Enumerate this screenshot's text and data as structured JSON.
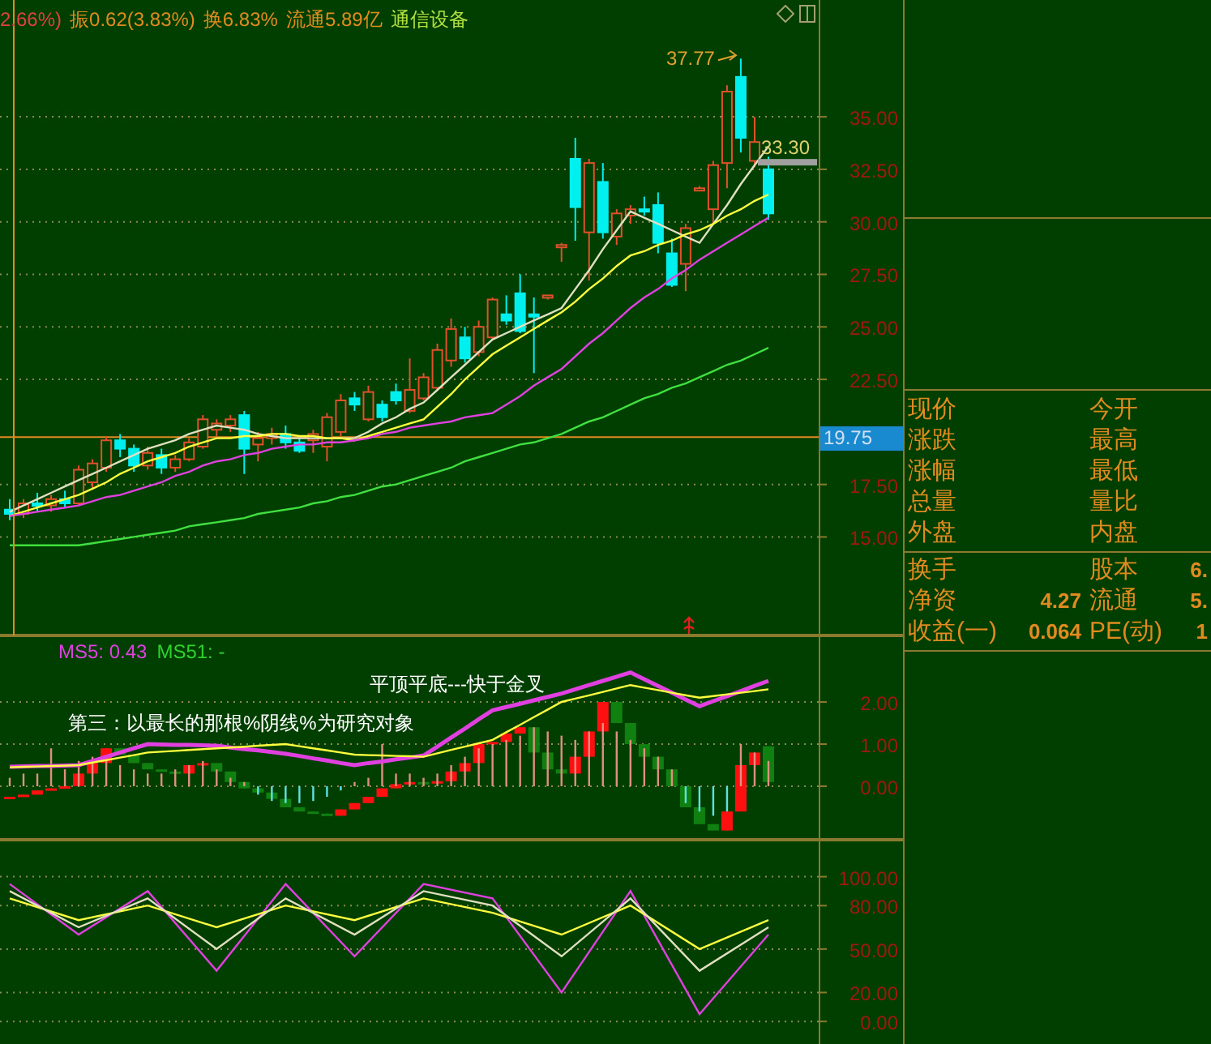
{
  "header": {
    "parts": [
      {
        "kind": "change",
        "text": "2.66%)"
      },
      {
        "kind": "stat",
        "text": "振0.62(3.83%)"
      },
      {
        "kind": "stat",
        "text": "换6.83%"
      },
      {
        "kind": "stat",
        "text": "流通5.89亿"
      },
      {
        "kind": "industry",
        "text": "通信设备"
      }
    ]
  },
  "price_chart": {
    "chart_data": {
      "type": "candlestick",
      "grid": true,
      "ylim": [
        10.31,
        40.56
      ],
      "yticks": [
        {
          "value": 15,
          "label": "15.00"
        },
        {
          "value": 17.5,
          "label": "17.50"
        },
        {
          "value": 22.5,
          "label": "22.50"
        },
        {
          "value": 25,
          "label": "25.00"
        },
        {
          "value": 27.5,
          "label": "27.50"
        },
        {
          "value": 30,
          "label": "30.00"
        },
        {
          "value": 32.5,
          "label": "32.50"
        },
        {
          "value": 35,
          "label": "35.00"
        }
      ],
      "ohlc": [
        [
          16.3,
          16.8,
          15.8,
          16.1
        ],
        [
          16.1,
          16.8,
          15.9,
          16.6
        ],
        [
          16.6,
          17.1,
          16.2,
          16.5
        ],
        [
          16.5,
          17.0,
          16.2,
          16.8
        ],
        [
          16.8,
          17.2,
          16.4,
          16.6
        ],
        [
          16.6,
          18.4,
          16.5,
          18.2
        ],
        [
          17.6,
          18.7,
          17.3,
          18.5
        ],
        [
          18.3,
          19.8,
          18.1,
          19.6
        ],
        [
          19.6,
          19.9,
          18.8,
          19.2
        ],
        [
          19.2,
          19.4,
          18.1,
          18.4
        ],
        [
          18.4,
          19.3,
          18.2,
          19.0
        ],
        [
          18.9,
          19.2,
          18.0,
          18.3
        ],
        [
          18.3,
          18.9,
          18.1,
          18.7
        ],
        [
          18.7,
          19.7,
          18.6,
          19.5
        ],
        [
          19.3,
          20.8,
          19.2,
          20.6
        ],
        [
          20.1,
          20.6,
          19.8,
          20.4
        ],
        [
          20.3,
          20.8,
          20.0,
          20.6
        ],
        [
          20.8,
          21.0,
          18.0,
          19.2
        ],
        [
          19.4,
          20.0,
          18.6,
          19.7
        ],
        [
          19.7,
          20.2,
          19.4,
          19.9
        ],
        [
          19.9,
          20.3,
          19.2,
          19.5
        ],
        [
          19.5,
          19.7,
          19.0,
          19.1
        ],
        [
          19.6,
          20.1,
          19.0,
          19.9
        ],
        [
          19.3,
          20.9,
          18.6,
          20.7
        ],
        [
          20.0,
          21.8,
          19.8,
          21.5
        ],
        [
          21.6,
          21.9,
          21.0,
          21.3
        ],
        [
          20.6,
          22.2,
          20.5,
          21.9
        ],
        [
          21.3,
          21.5,
          20.5,
          20.7
        ],
        [
          21.9,
          22.3,
          21.3,
          21.5
        ],
        [
          21.0,
          23.5,
          20.9,
          22.0
        ],
        [
          21.6,
          22.8,
          21.5,
          22.6
        ],
        [
          22.1,
          24.2,
          22.0,
          23.9
        ],
        [
          23.4,
          25.4,
          23.1,
          24.9
        ],
        [
          24.5,
          25.0,
          23.3,
          23.5
        ],
        [
          23.8,
          25.3,
          23.6,
          25.0
        ],
        [
          24.5,
          26.4,
          24.4,
          26.3
        ],
        [
          25.6,
          26.5,
          25.1,
          25.3
        ],
        [
          26.6,
          27.5,
          24.7,
          24.8
        ],
        [
          25.6,
          26.4,
          22.8,
          25.5
        ],
        [
          26.4,
          26.5,
          26.3,
          26.5
        ],
        [
          28.9,
          29.0,
          28.1,
          28.9
        ],
        [
          33.0,
          34.0,
          29.1,
          30.7
        ],
        [
          29.5,
          33.0,
          27.2,
          32.8
        ],
        [
          31.9,
          32.8,
          29.2,
          29.5
        ],
        [
          29.3,
          30.6,
          28.9,
          30.4
        ],
        [
          30.3,
          30.8,
          29.9,
          30.6
        ],
        [
          30.6,
          31.2,
          30.3,
          30.5
        ],
        [
          30.8,
          31.4,
          28.5,
          29.0
        ],
        [
          28.5,
          29.2,
          26.9,
          27.0
        ],
        [
          28.0,
          29.9,
          26.7,
          29.7
        ],
        [
          31.6,
          31.7,
          31.5,
          31.6
        ],
        [
          30.6,
          32.9,
          29.9,
          32.7
        ],
        [
          32.8,
          36.5,
          31.6,
          36.2
        ],
        [
          36.9,
          37.77,
          33.3,
          34.0
        ],
        [
          32.9,
          35.0,
          32.6,
          33.8
        ],
        [
          32.5,
          33.1,
          30.1,
          30.4
        ]
      ],
      "series": [
        {
          "type": "line",
          "color": "#e0e0c0",
          "values": [
            16.2,
            16.5,
            16.8,
            17.1,
            17.4,
            17.7,
            18.0,
            18.3,
            18.6,
            18.9,
            19.2,
            19.4,
            19.6,
            19.9,
            20.1,
            20.3,
            20.2,
            20.1,
            19.9,
            19.8,
            19.7,
            19.7,
            19.7,
            19.7,
            19.7,
            19.7,
            20.0,
            20.4,
            20.7,
            21.1,
            21.4,
            22.0,
            22.6,
            23.2,
            23.8,
            24.4,
            24.7,
            25.0,
            25.3,
            25.6,
            25.9,
            26.8,
            27.7,
            28.7,
            29.6,
            30.5,
            30.2,
            29.9,
            29.6,
            29.3,
            29.0,
            29.9,
            30.8,
            31.8,
            32.7,
            33.6
          ]
        },
        {
          "type": "line",
          "color": "#ffff40",
          "values": [
            16.0,
            16.2,
            16.4,
            16.6,
            16.8,
            17.0,
            17.3,
            17.6,
            18.0,
            18.3,
            18.6,
            18.8,
            19.0,
            19.3,
            19.5,
            19.7,
            19.7,
            19.8,
            19.8,
            19.9,
            19.9,
            19.8,
            19.8,
            19.7,
            19.7,
            19.6,
            19.8,
            20.0,
            20.2,
            20.4,
            20.6,
            21.2,
            21.8,
            22.5,
            23.1,
            23.7,
            24.1,
            24.5,
            24.9,
            25.3,
            25.7,
            26.2,
            26.8,
            27.3,
            27.9,
            28.4,
            28.6,
            28.9,
            29.1,
            29.4,
            29.6,
            29.9,
            30.3,
            30.6,
            31.0,
            31.3
          ]
        },
        {
          "type": "line",
          "color": "#e040e0",
          "values": [
            16.0,
            16.1,
            16.2,
            16.3,
            16.4,
            16.5,
            16.7,
            16.9,
            17.0,
            17.2,
            17.4,
            17.6,
            17.9,
            18.1,
            18.4,
            18.6,
            18.7,
            18.9,
            19.0,
            19.2,
            19.3,
            19.4,
            19.4,
            19.5,
            19.5,
            19.6,
            19.7,
            19.9,
            20.0,
            20.2,
            20.3,
            20.4,
            20.5,
            20.7,
            20.8,
            20.9,
            21.3,
            21.7,
            22.2,
            22.6,
            23.0,
            23.6,
            24.2,
            24.7,
            25.3,
            25.9,
            26.4,
            26.8,
            27.3,
            27.7,
            28.2,
            28.6,
            29.0,
            29.4,
            29.8,
            30.2
          ]
        },
        {
          "type": "line",
          "color": "#40e040",
          "values": [
            14.6,
            14.6,
            14.6,
            14.6,
            14.6,
            14.6,
            14.7,
            14.8,
            14.9,
            15.0,
            15.1,
            15.2,
            15.3,
            15.5,
            15.6,
            15.7,
            15.8,
            15.9,
            16.1,
            16.2,
            16.3,
            16.4,
            16.6,
            16.7,
            16.9,
            17.0,
            17.2,
            17.4,
            17.5,
            17.7,
            17.9,
            18.1,
            18.3,
            18.6,
            18.8,
            19.0,
            19.2,
            19.4,
            19.5,
            19.7,
            19.9,
            20.2,
            20.5,
            20.7,
            21.0,
            21.3,
            21.6,
            21.8,
            22.1,
            22.3,
            22.6,
            22.9,
            23.2,
            23.4,
            23.7,
            24.0
          ]
        }
      ],
      "ref_lines": [
        {
          "axis": "y",
          "value": 19.75,
          "color": "#e08a20"
        }
      ],
      "annotations": [
        "37.77",
        "33.30"
      ]
    },
    "current_price": "19.75"
  },
  "indicator_chart": {
    "legend": [
      {
        "text": "MS5: 0.43",
        "color": "#e040e0"
      },
      {
        "text": "MS51: -",
        "color": "#30d030"
      }
    ],
    "notes": [
      "平顶平底---快于金叉",
      "第三：以最长的那根%阴线%为研究对象"
    ],
    "chart_data": {
      "type": "candlestick",
      "grid": true,
      "ylim": [
        -1.27,
        3.54
      ],
      "yticks": [
        {
          "value": 0,
          "label": "0.00"
        },
        {
          "value": 1,
          "label": "1.00"
        },
        {
          "value": 2,
          "label": "2.00"
        }
      ],
      "ohlc": [
        [
          -0.3,
          -0.25,
          -0.3,
          -0.25
        ],
        [
          -0.25,
          -0.2,
          -0.25,
          -0.2
        ],
        [
          -0.2,
          -0.1,
          -0.2,
          -0.1
        ],
        [
          -0.1,
          -0.05,
          -0.1,
          -0.05
        ],
        [
          -0.05,
          0.0,
          -0.05,
          0.0
        ],
        [
          0.0,
          0.3,
          0.0,
          0.3
        ],
        [
          0.3,
          0.55,
          0.3,
          0.55
        ],
        [
          0.55,
          0.9,
          0.55,
          0.9
        ],
        [
          0.9,
          0.9,
          0.75,
          0.75
        ],
        [
          0.75,
          0.75,
          0.55,
          0.55
        ],
        [
          0.55,
          0.55,
          0.4,
          0.4
        ],
        [
          0.4,
          0.4,
          0.35,
          0.35
        ],
        [
          0.35,
          0.35,
          0.3,
          0.3
        ],
        [
          0.3,
          0.5,
          0.3,
          0.5
        ],
        [
          0.5,
          0.55,
          0.5,
          0.55
        ],
        [
          0.55,
          0.55,
          0.35,
          0.35
        ],
        [
          0.35,
          0.35,
          0.1,
          0.1
        ],
        [
          0.1,
          0.1,
          -0.05,
          -0.05
        ],
        [
          -0.05,
          -0.05,
          -0.15,
          -0.15
        ],
        [
          -0.15,
          -0.15,
          -0.3,
          -0.3
        ],
        [
          -0.3,
          -0.3,
          -0.5,
          -0.5
        ],
        [
          -0.5,
          -0.5,
          -0.6,
          -0.6
        ],
        [
          -0.6,
          -0.6,
          -0.65,
          -0.65
        ],
        [
          -0.65,
          -0.65,
          -0.7,
          -0.7
        ],
        [
          -0.7,
          -0.55,
          -0.7,
          -0.55
        ],
        [
          -0.55,
          -0.4,
          -0.55,
          -0.4
        ],
        [
          -0.4,
          -0.25,
          -0.4,
          -0.25
        ],
        [
          -0.25,
          -0.05,
          -0.25,
          -0.05
        ],
        [
          -0.05,
          0.05,
          -0.05,
          0.05
        ],
        [
          0.05,
          0.1,
          0.05,
          0.1
        ],
        [
          0.1,
          0.1,
          0.08,
          0.08
        ],
        [
          0.08,
          0.12,
          0.08,
          0.12
        ],
        [
          0.12,
          0.35,
          0.12,
          0.35
        ],
        [
          0.35,
          0.55,
          0.35,
          0.55
        ],
        [
          0.55,
          1.0,
          0.55,
          1.0
        ],
        [
          1.0,
          1.05,
          1.0,
          1.05
        ],
        [
          1.05,
          1.25,
          1.05,
          1.25
        ],
        [
          1.25,
          1.4,
          1.25,
          1.4
        ],
        [
          1.4,
          1.4,
          0.8,
          0.8
        ],
        [
          0.8,
          0.8,
          0.4,
          0.4
        ],
        [
          0.4,
          0.4,
          0.3,
          0.3
        ],
        [
          0.3,
          0.7,
          0.3,
          0.7
        ],
        [
          0.7,
          1.3,
          0.7,
          1.3
        ],
        [
          1.3,
          2.0,
          1.3,
          2.0
        ],
        [
          2.0,
          2.0,
          1.5,
          1.5
        ],
        [
          1.5,
          1.5,
          1.0,
          1.0
        ],
        [
          1.0,
          1.0,
          0.7,
          0.7
        ],
        [
          0.7,
          0.7,
          0.4,
          0.4
        ],
        [
          0.4,
          0.4,
          0.0,
          0.0
        ],
        [
          0.0,
          0.0,
          -0.5,
          -0.5
        ],
        [
          -0.5,
          -0.5,
          -0.9,
          -0.9
        ],
        [
          -0.9,
          -0.9,
          -1.05,
          -1.05
        ],
        [
          -1.05,
          -0.6,
          -1.05,
          -0.6
        ],
        [
          -0.6,
          0.5,
          -0.6,
          0.5
        ],
        [
          0.5,
          0.8,
          0.5,
          0.8
        ],
        [
          0.95,
          0.95,
          0.1,
          0.1
        ]
      ],
      "series": [
        {
          "type": "line",
          "color": "#e040e0",
          "values": [
            0.46,
            0.47,
            0.48,
            0.48,
            0.49,
            0.5,
            0.6,
            0.7,
            0.8,
            0.9,
            1.0,
            0.99,
            0.98,
            0.98,
            0.97,
            0.96,
            0.92,
            0.88,
            0.85,
            0.81,
            0.77,
            0.72,
            0.66,
            0.61,
            0.55,
            0.5,
            0.55,
            0.59,
            0.64,
            0.68,
            0.73,
            0.94,
            1.16,
            1.37,
            1.59,
            1.8,
            1.88,
            1.96,
            2.04,
            2.12,
            2.2,
            2.3,
            2.4,
            2.5,
            2.6,
            2.7,
            2.54,
            2.38,
            2.22,
            2.06,
            1.9,
            2.02,
            2.14,
            2.26,
            2.38,
            2.5
          ]
        },
        {
          "type": "line",
          "color": "#ffff40",
          "values": [
            0.45,
            0.46,
            0.47,
            0.48,
            0.49,
            0.5,
            0.56,
            0.62,
            0.68,
            0.74,
            0.8,
            0.82,
            0.84,
            0.86,
            0.88,
            0.9,
            0.92,
            0.94,
            0.96,
            0.98,
            1.0,
            0.95,
            0.9,
            0.85,
            0.8,
            0.75,
            0.74,
            0.73,
            0.72,
            0.71,
            0.7,
            0.78,
            0.86,
            0.94,
            1.02,
            1.1,
            1.28,
            1.46,
            1.64,
            1.82,
            2.0,
            2.08,
            2.16,
            2.24,
            2.32,
            2.4,
            2.34,
            2.28,
            2.22,
            2.16,
            2.1,
            2.14,
            2.18,
            2.22,
            2.26,
            2.3
          ]
        },
        {
          "type": "bar",
          "color": "#e09080",
          "values": [
            0.2,
            0.3,
            0.3,
            0.9,
            0.4,
            0.6,
            0.7,
            0.6,
            0.5,
            0.4,
            0.3,
            0.3,
            0.4,
            0.5,
            0.6,
            0.4,
            0.2,
            0.1,
            null,
            null,
            null,
            null,
            null,
            null,
            null,
            0.1,
            0.2,
            1.0,
            0.3,
            0.3,
            0.2,
            0.3,
            0.5,
            0.7,
            0.9,
            1.0,
            1.1,
            1.2,
            1.4,
            1.3,
            1.2,
            1.1,
            1.3,
            1.5,
            1.3,
            1.1,
            0.9,
            0.7,
            0.4,
            null,
            null,
            null,
            null,
            1.0,
            0.8,
            0.6
          ]
        },
        {
          "type": "bar",
          "color": "#60e0e0",
          "values": [
            null,
            null,
            null,
            null,
            null,
            null,
            null,
            null,
            null,
            null,
            null,
            null,
            null,
            null,
            null,
            null,
            null,
            null,
            -0.2,
            -0.35,
            -0.4,
            -0.4,
            -0.35,
            -0.25,
            -0.1,
            null,
            null,
            null,
            null,
            null,
            null,
            null,
            null,
            null,
            null,
            null,
            null,
            null,
            null,
            null,
            null,
            null,
            null,
            null,
            null,
            null,
            null,
            null,
            null,
            -0.4,
            -0.6,
            -0.7,
            -0.6,
            null,
            null,
            null
          ]
        }
      ]
    }
  },
  "oscillator_chart": {
    "chart_data": {
      "type": "line",
      "grid": true,
      "ylim": [
        -16.7,
        124.4
      ],
      "yticks": [
        {
          "value": 0,
          "label": "0.00"
        },
        {
          "value": 20,
          "label": "20.00"
        },
        {
          "value": 50,
          "label": "50.00"
        },
        {
          "value": 80,
          "label": "80.00"
        },
        {
          "value": 100,
          "label": "100.00"
        }
      ],
      "series": [
        {
          "color": "#e040e0",
          "values": [
            95,
            60,
            90,
            35,
            95,
            45,
            95,
            85,
            20,
            90,
            5,
            60
          ]
        },
        {
          "color": "#ffff40",
          "values": [
            85,
            70,
            80,
            65,
            80,
            70,
            85,
            75,
            60,
            80,
            50,
            70
          ]
        },
        {
          "color": "#e0e0c0",
          "values": [
            90,
            65,
            85,
            50,
            85,
            60,
            90,
            80,
            45,
            85,
            35,
            65
          ]
        }
      ]
    }
  },
  "quote_panel": {
    "rows": [
      {
        "left_label": "现价",
        "right_label": "今开"
      },
      {
        "left_label": "涨跌",
        "right_label": "最高"
      },
      {
        "left_label": "涨幅",
        "right_label": "最低"
      },
      {
        "left_label": "总量",
        "right_label": "量比"
      },
      {
        "left_label": "外盘",
        "right_label": "内盘"
      }
    ],
    "finance_rows": [
      {
        "left_label": "换手",
        "right_label": "股本",
        "right_value": "6."
      },
      {
        "left_label": "净资",
        "left_value": "4.27",
        "right_label": "流通",
        "right_value": "5."
      },
      {
        "left_label": "收益(一)",
        "left_value": "0.064",
        "right_label": "PE(动)",
        "right_value": "1"
      }
    ]
  }
}
